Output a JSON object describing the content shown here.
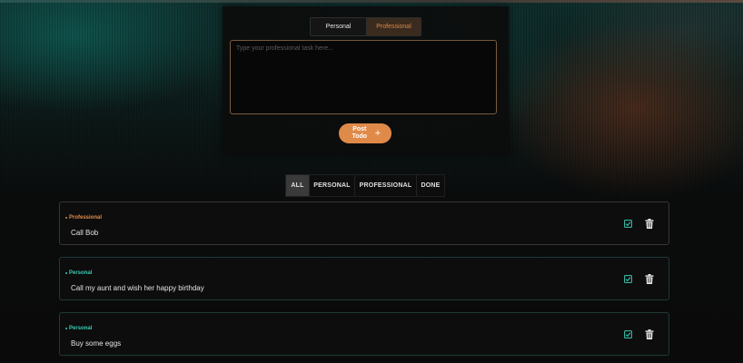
{
  "composer": {
    "tabs": [
      {
        "label": "Personal",
        "active": false
      },
      {
        "label": "Professional",
        "active": true
      }
    ],
    "textarea_placeholder": "Type your professional task here...",
    "textarea_value": "",
    "post_button_label_line1": "Post",
    "post_button_label_line2": "Todo",
    "post_button_icon": "plus-icon"
  },
  "filters": {
    "tabs": [
      {
        "label": "ALL",
        "active": true
      },
      {
        "label": "PERSONAL",
        "active": false
      },
      {
        "label": "PROFESSIONAL",
        "active": false
      },
      {
        "label": "DONE",
        "active": false
      }
    ]
  },
  "todos": [
    {
      "category": "Professional",
      "text": "Call Bob"
    },
    {
      "category": "Personal",
      "text": "Call my aunt and wish her happy birthday"
    },
    {
      "category": "Personal",
      "text": "Buy some eggs"
    }
  ],
  "colors": {
    "accent_professional": "#e08a4a",
    "accent_personal": "#3ccbb4",
    "check_icon": "#3ccbb4",
    "background": "#0a0b0b"
  }
}
